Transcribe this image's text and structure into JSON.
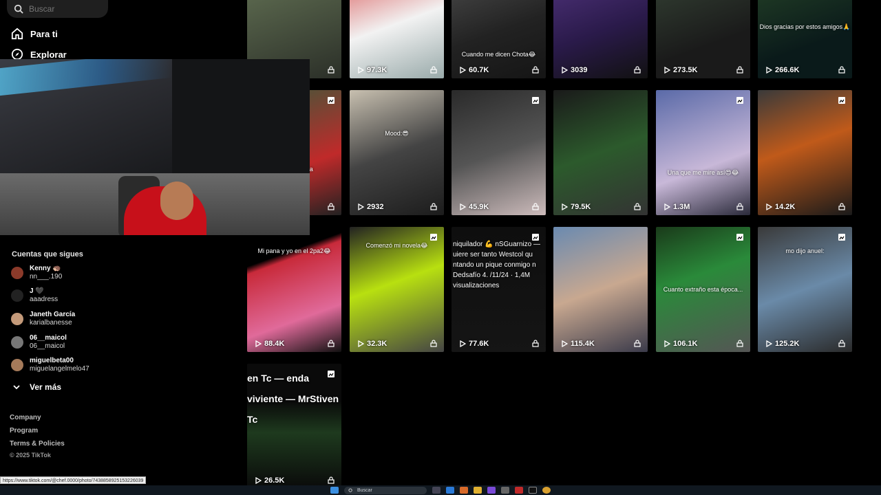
{
  "search": {
    "placeholder": "Buscar"
  },
  "nav": [
    {
      "label": "Para ti",
      "icon": "home-icon"
    },
    {
      "label": "Explorar",
      "icon": "compass-icon"
    }
  ],
  "following": {
    "title": "Cuentas que sigues",
    "accounts": [
      {
        "name": "Kenny 🦔",
        "username": "nn___.190"
      },
      {
        "name": "J 🖤",
        "username": "aaadress"
      },
      {
        "name": "Janeth García",
        "username": "karialbanesse"
      },
      {
        "name": "06__maicol",
        "username": "06__maicol"
      },
      {
        "name": "miguelbeta00",
        "username": "miguelangelmelo47"
      }
    ],
    "see_more": "Ver más"
  },
  "footer": {
    "links": [
      "Company",
      "Program",
      "Terms & Policies"
    ],
    "copyright": "© 2025 TikTok"
  },
  "videos": [
    {
      "views": "",
      "caption": ""
    },
    {
      "views": "97.3K",
      "caption": ""
    },
    {
      "views": "60.7K",
      "caption": "Cuando me dicen Chota😂"
    },
    {
      "views": "3039",
      "caption": ""
    },
    {
      "views": "273.5K",
      "caption": ""
    },
    {
      "views": "266.6K",
      "caption": "Dios gracias por estos amigos🙏"
    },
    {
      "views": "",
      "caption": "era y miedo a"
    },
    {
      "views": "2932",
      "caption": "Mood:😎"
    },
    {
      "views": "45.9K",
      "caption": ""
    },
    {
      "views": "79.5K",
      "caption": ""
    },
    {
      "views": "1.3M",
      "caption": "Una que me mire así😍😂"
    },
    {
      "views": "14.2K",
      "caption": ""
    },
    {
      "views": "88.4K",
      "caption": "Mi pana y yo en el 2pa2😂"
    },
    {
      "views": "32.3K",
      "caption": "Comenzó mi novela😂"
    },
    {
      "views": "77.6K",
      "caption": "niquilador 💪 nSGuarnizo — uiere ser tanto Westcol qu ntando un pique conmigo n Dedsafío 4. /11/24 · 1,4M visualizaciones"
    },
    {
      "views": "115.4K",
      "caption": ""
    },
    {
      "views": "106.1K",
      "caption": "Cuanto extraño esta época..."
    },
    {
      "views": "125.2K",
      "caption": "mo dijo anuel:"
    },
    {
      "views": "26.5K",
      "caption": "en Tc — enda viviente — MrStiven Tc"
    }
  ],
  "status_url": "https://www.tiktok.com/@chef.0000/photo/7438858925153226039",
  "taskbar": {
    "search": "Buscar"
  }
}
